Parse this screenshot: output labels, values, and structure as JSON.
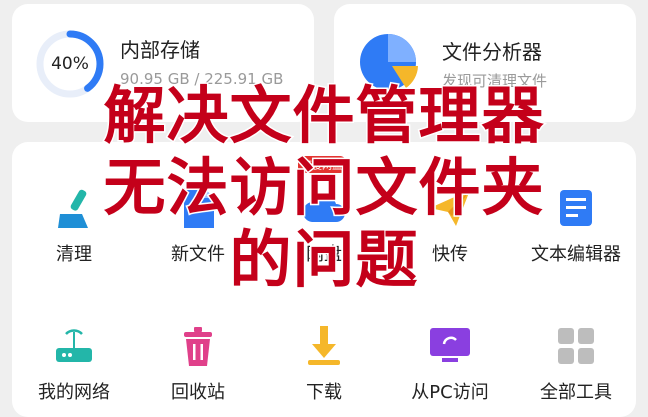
{
  "storage": {
    "percent_label": "40%",
    "percent": 0.4,
    "title": "内部存储",
    "usage": "90.95 GB / 225.91 GB"
  },
  "analyzer": {
    "title": "文件分析器",
    "subtitle": "发现可清理文件"
  },
  "tools": [
    {
      "label": "清理",
      "icon": "broom-icon"
    },
    {
      "label": "新文件",
      "icon": "new-file-icon"
    },
    {
      "label": "网盘",
      "icon": "cloud-drive-icon",
      "badge": "百度网盘"
    },
    {
      "label": "快传",
      "icon": "paper-plane-icon"
    },
    {
      "label": "文本编辑器",
      "icon": "text-editor-icon"
    },
    {
      "label": "我的网络",
      "icon": "router-icon"
    },
    {
      "label": "回收站",
      "icon": "trash-icon"
    },
    {
      "label": "下载",
      "icon": "download-icon"
    },
    {
      "label": "从PC访问",
      "icon": "pc-access-icon"
    },
    {
      "label": "全部工具",
      "icon": "grid-icon"
    }
  ],
  "overlay": {
    "line1": "解决文件管理器",
    "line2": "无法访问文件夹",
    "line3": "的问题"
  },
  "colors": {
    "accent_blue": "#2f7bf5",
    "pie_yellow": "#f5b72a",
    "tool_teal": "#23b6a9",
    "tool_pink": "#e0408a",
    "tool_purple": "#8a3fe0",
    "overlay_red": "#c4001a"
  }
}
